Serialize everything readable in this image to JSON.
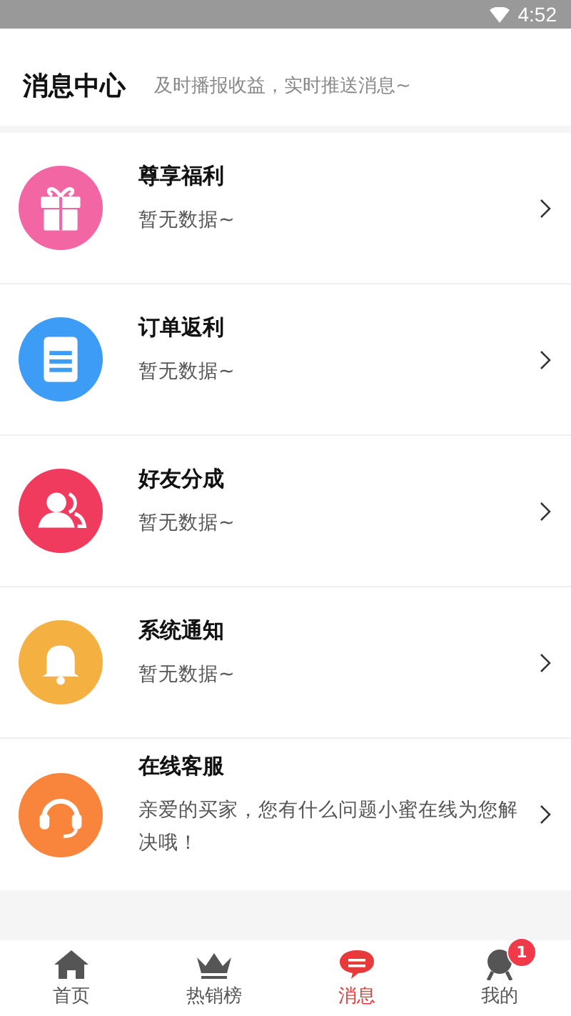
{
  "status_bar": {
    "time": "4:52"
  },
  "header": {
    "title": "消息中心",
    "subtitle": "及时播报收益，实时推送消息~"
  },
  "messages": [
    {
      "kind": "gift",
      "color": "#f266a4",
      "title": "尊享福利",
      "text": "暂无数据~"
    },
    {
      "kind": "order",
      "color": "#3d9cf5",
      "title": "订单返利",
      "text": "暂无数据~"
    },
    {
      "kind": "friends",
      "color": "#f03a5e",
      "title": "好友分成",
      "text": "暂无数据~"
    },
    {
      "kind": "notice",
      "color": "#f5b042",
      "title": "系统通知",
      "text": "暂无数据~"
    },
    {
      "kind": "service",
      "color": "#f9843c",
      "title": "在线客服",
      "text": "亲爱的买家，您有什么问题小蜜在线为您解决哦！"
    }
  ],
  "tabs": [
    {
      "kind": "home",
      "label": "首页",
      "selected": false
    },
    {
      "kind": "crown",
      "label": "热销榜",
      "selected": false
    },
    {
      "kind": "message",
      "label": "消息",
      "selected": true
    },
    {
      "kind": "me",
      "label": "我的",
      "selected": false,
      "badge": "1"
    }
  ]
}
